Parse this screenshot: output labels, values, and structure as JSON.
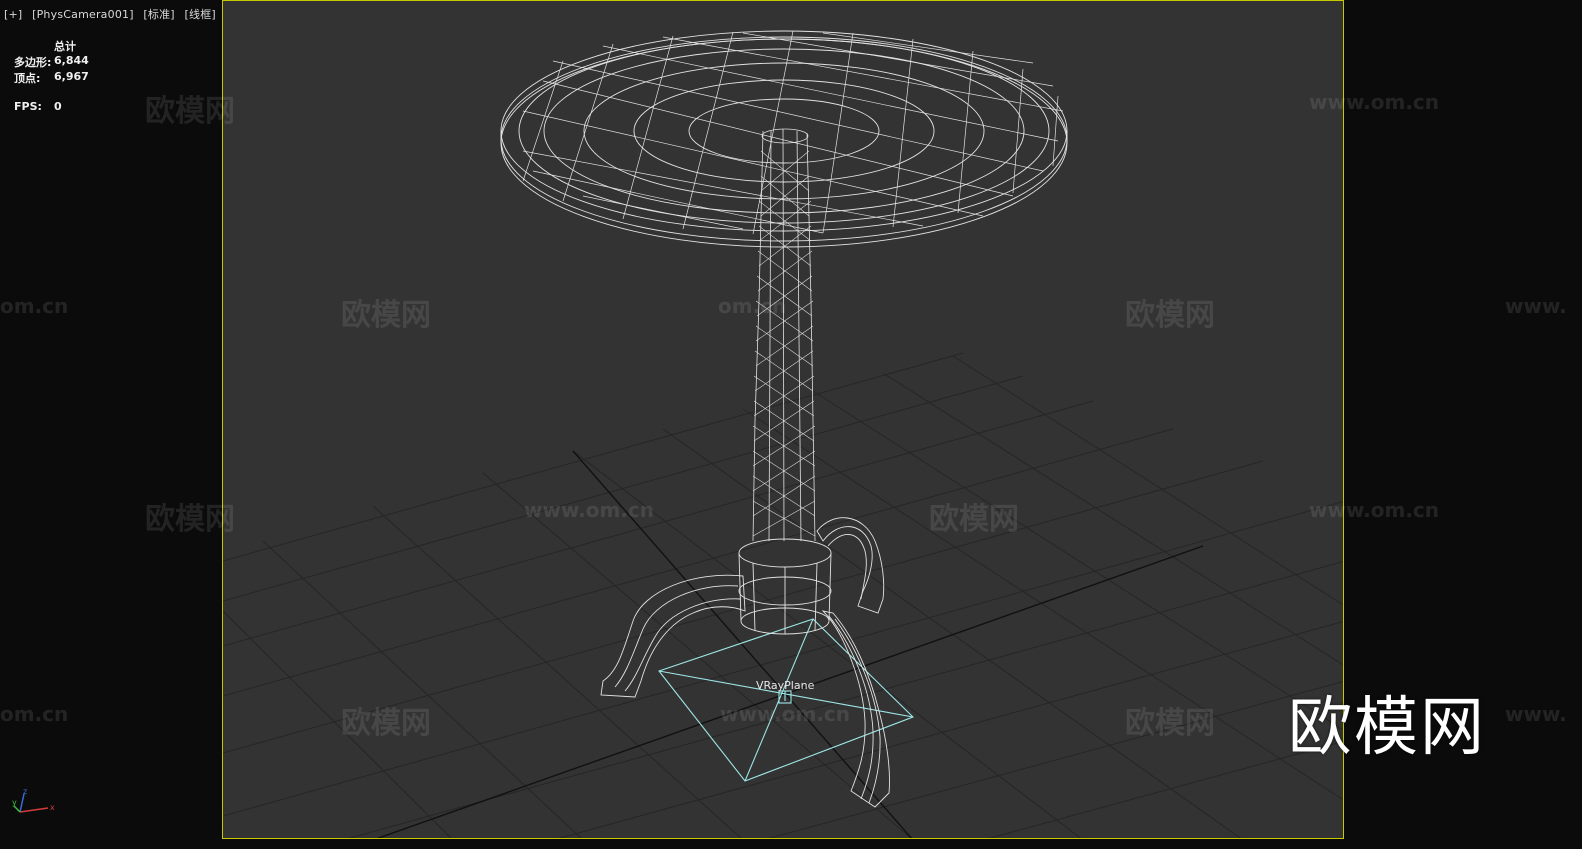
{
  "viewport_header": {
    "plus": "[+]",
    "camera": "[PhysCamera001]",
    "mode": "[标准]",
    "shading": "[线框]"
  },
  "stats": {
    "total_label": "总计",
    "polys_label": "多边形:",
    "polys_value": "6,844",
    "verts_label": "顶点:",
    "verts_value": "6,967",
    "fps_label": "FPS:",
    "fps_value": "0"
  },
  "object_label": "VRayPlane",
  "watermarks": {
    "cn": "欧模网",
    "url": "www.om.cn",
    "url_short": "om.cn",
    "url_cut": "www."
  },
  "brand_logo": "欧模网",
  "gizmo_axes": {
    "x": "x",
    "y": "y",
    "z": "z"
  },
  "colors": {
    "viewport_bg": "#333333",
    "viewport_border": "#c8c800",
    "wireframe": "#e8e8e8",
    "grid": "#1a1a1a",
    "vray_plane": "#9ee6e6"
  }
}
